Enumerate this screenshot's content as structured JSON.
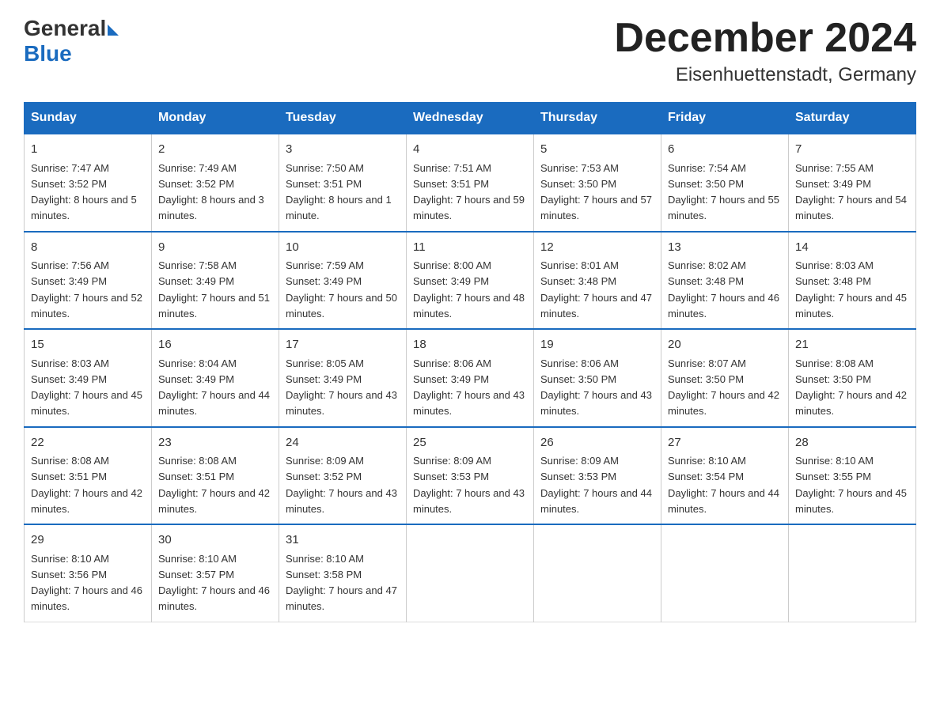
{
  "header": {
    "logo_general": "General",
    "logo_blue": "Blue",
    "month_title": "December 2024",
    "location": "Eisenhuettenstadt, Germany"
  },
  "weekdays": [
    "Sunday",
    "Monday",
    "Tuesday",
    "Wednesday",
    "Thursday",
    "Friday",
    "Saturday"
  ],
  "weeks": [
    [
      {
        "day": "1",
        "sunrise": "7:47 AM",
        "sunset": "3:52 PM",
        "daylight": "8 hours and 5 minutes."
      },
      {
        "day": "2",
        "sunrise": "7:49 AM",
        "sunset": "3:52 PM",
        "daylight": "8 hours and 3 minutes."
      },
      {
        "day": "3",
        "sunrise": "7:50 AM",
        "sunset": "3:51 PM",
        "daylight": "8 hours and 1 minute."
      },
      {
        "day": "4",
        "sunrise": "7:51 AM",
        "sunset": "3:51 PM",
        "daylight": "7 hours and 59 minutes."
      },
      {
        "day": "5",
        "sunrise": "7:53 AM",
        "sunset": "3:50 PM",
        "daylight": "7 hours and 57 minutes."
      },
      {
        "day": "6",
        "sunrise": "7:54 AM",
        "sunset": "3:50 PM",
        "daylight": "7 hours and 55 minutes."
      },
      {
        "day": "7",
        "sunrise": "7:55 AM",
        "sunset": "3:49 PM",
        "daylight": "7 hours and 54 minutes."
      }
    ],
    [
      {
        "day": "8",
        "sunrise": "7:56 AM",
        "sunset": "3:49 PM",
        "daylight": "7 hours and 52 minutes."
      },
      {
        "day": "9",
        "sunrise": "7:58 AM",
        "sunset": "3:49 PM",
        "daylight": "7 hours and 51 minutes."
      },
      {
        "day": "10",
        "sunrise": "7:59 AM",
        "sunset": "3:49 PM",
        "daylight": "7 hours and 50 minutes."
      },
      {
        "day": "11",
        "sunrise": "8:00 AM",
        "sunset": "3:49 PM",
        "daylight": "7 hours and 48 minutes."
      },
      {
        "day": "12",
        "sunrise": "8:01 AM",
        "sunset": "3:48 PM",
        "daylight": "7 hours and 47 minutes."
      },
      {
        "day": "13",
        "sunrise": "8:02 AM",
        "sunset": "3:48 PM",
        "daylight": "7 hours and 46 minutes."
      },
      {
        "day": "14",
        "sunrise": "8:03 AM",
        "sunset": "3:48 PM",
        "daylight": "7 hours and 45 minutes."
      }
    ],
    [
      {
        "day": "15",
        "sunrise": "8:03 AM",
        "sunset": "3:49 PM",
        "daylight": "7 hours and 45 minutes."
      },
      {
        "day": "16",
        "sunrise": "8:04 AM",
        "sunset": "3:49 PM",
        "daylight": "7 hours and 44 minutes."
      },
      {
        "day": "17",
        "sunrise": "8:05 AM",
        "sunset": "3:49 PM",
        "daylight": "7 hours and 43 minutes."
      },
      {
        "day": "18",
        "sunrise": "8:06 AM",
        "sunset": "3:49 PM",
        "daylight": "7 hours and 43 minutes."
      },
      {
        "day": "19",
        "sunrise": "8:06 AM",
        "sunset": "3:50 PM",
        "daylight": "7 hours and 43 minutes."
      },
      {
        "day": "20",
        "sunrise": "8:07 AM",
        "sunset": "3:50 PM",
        "daylight": "7 hours and 42 minutes."
      },
      {
        "day": "21",
        "sunrise": "8:08 AM",
        "sunset": "3:50 PM",
        "daylight": "7 hours and 42 minutes."
      }
    ],
    [
      {
        "day": "22",
        "sunrise": "8:08 AM",
        "sunset": "3:51 PM",
        "daylight": "7 hours and 42 minutes."
      },
      {
        "day": "23",
        "sunrise": "8:08 AM",
        "sunset": "3:51 PM",
        "daylight": "7 hours and 42 minutes."
      },
      {
        "day": "24",
        "sunrise": "8:09 AM",
        "sunset": "3:52 PM",
        "daylight": "7 hours and 43 minutes."
      },
      {
        "day": "25",
        "sunrise": "8:09 AM",
        "sunset": "3:53 PM",
        "daylight": "7 hours and 43 minutes."
      },
      {
        "day": "26",
        "sunrise": "8:09 AM",
        "sunset": "3:53 PM",
        "daylight": "7 hours and 44 minutes."
      },
      {
        "day": "27",
        "sunrise": "8:10 AM",
        "sunset": "3:54 PM",
        "daylight": "7 hours and 44 minutes."
      },
      {
        "day": "28",
        "sunrise": "8:10 AM",
        "sunset": "3:55 PM",
        "daylight": "7 hours and 45 minutes."
      }
    ],
    [
      {
        "day": "29",
        "sunrise": "8:10 AM",
        "sunset": "3:56 PM",
        "daylight": "7 hours and 46 minutes."
      },
      {
        "day": "30",
        "sunrise": "8:10 AM",
        "sunset": "3:57 PM",
        "daylight": "7 hours and 46 minutes."
      },
      {
        "day": "31",
        "sunrise": "8:10 AM",
        "sunset": "3:58 PM",
        "daylight": "7 hours and 47 minutes."
      },
      null,
      null,
      null,
      null
    ]
  ]
}
